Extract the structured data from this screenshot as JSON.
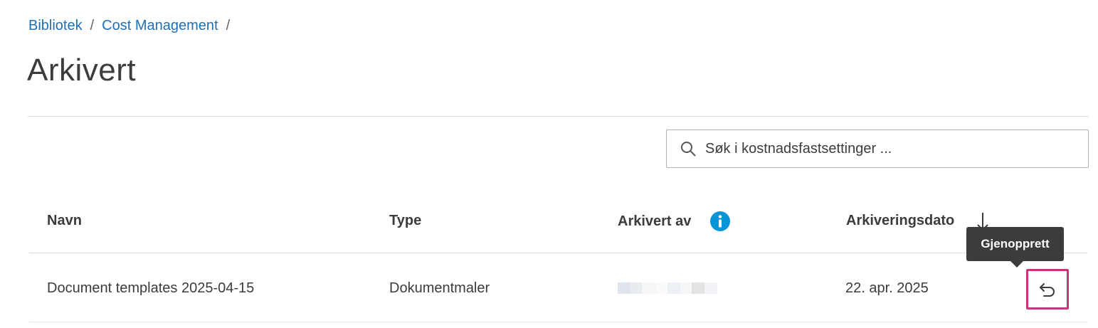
{
  "breadcrumb": {
    "items": [
      "Bibliotek",
      "Cost Management"
    ],
    "separator": "/"
  },
  "page": {
    "title": "Arkivert"
  },
  "search": {
    "placeholder": "Søk i kostnadsfastsettinger ..."
  },
  "table": {
    "columns": {
      "name": "Navn",
      "type": "Type",
      "archived_by": "Arkivert av",
      "archived_date": "Arkiveringsdato"
    },
    "sort": {
      "column": "archived_date",
      "direction": "descending"
    },
    "rows": [
      {
        "name": "Document templates 2025-04-15",
        "type": "Dokumentmaler",
        "archived_by": "",
        "archived_date": "22. apr. 2025"
      }
    ]
  },
  "tooltip": {
    "restore": "Gjenopprett"
  },
  "colors": {
    "link": "#1f6fb3",
    "info": "#0696d7",
    "focus_outline": "#c8357a",
    "tooltip_bg": "#3c3c3c"
  },
  "icons": {
    "search": "search-icon",
    "info": "info-icon",
    "sort": "arrow-down-icon",
    "restore": "undo-icon"
  }
}
